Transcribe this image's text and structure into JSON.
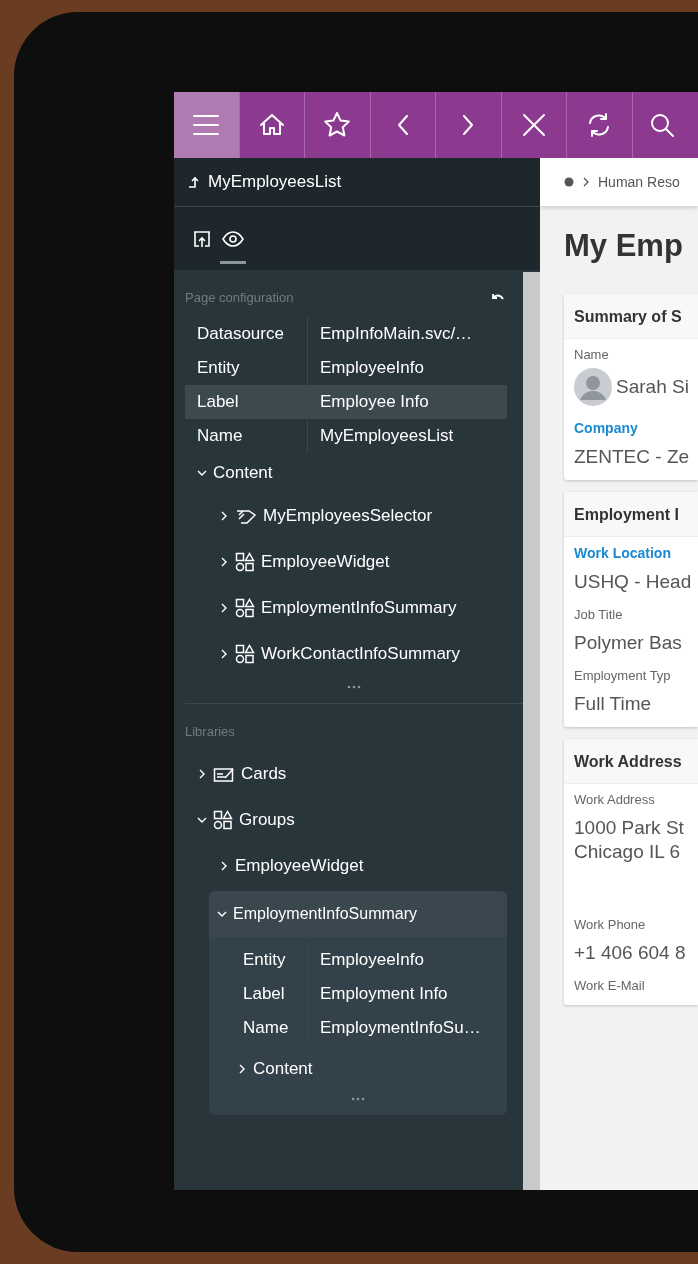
{
  "toolbar": {
    "buttons": [
      {
        "kind": "menu",
        "selected": true
      },
      {
        "kind": "home",
        "selected": false
      },
      {
        "kind": "star",
        "selected": false
      },
      {
        "kind": "back",
        "selected": false
      },
      {
        "kind": "forward",
        "selected": false
      },
      {
        "kind": "close",
        "selected": false
      },
      {
        "kind": "refresh",
        "selected": false
      },
      {
        "kind": "search",
        "selected": false
      }
    ]
  },
  "panel": {
    "title": "MyEmployeesList",
    "tabs": [
      {
        "kind": "publish",
        "selected": false
      },
      {
        "kind": "preview",
        "selected": true
      }
    ],
    "page_configuration": {
      "heading": "Page configuration",
      "properties": [
        {
          "name": "Datasource",
          "value": "EmpInfoMain.svc/…",
          "selected": false
        },
        {
          "name": "Entity",
          "value": "EmployeeInfo",
          "selected": false
        },
        {
          "name": "Label",
          "value": "Employee Info",
          "selected": true
        },
        {
          "name": "Name",
          "value": "MyEmployeesList",
          "selected": false
        }
      ],
      "content": {
        "label": "Content",
        "expanded": true,
        "children": [
          {
            "label": "MyEmployeesSelector",
            "kind": "selector",
            "expanded": false
          },
          {
            "label": "EmployeeWidget",
            "kind": "group",
            "expanded": false
          },
          {
            "label": "EmploymentInfoSummary",
            "kind": "group",
            "expanded": false
          },
          {
            "label": "WorkContactInfoSummary",
            "kind": "group",
            "expanded": false
          }
        ]
      }
    },
    "libraries": {
      "heading": "Libraries",
      "items": [
        {
          "label": "Cards",
          "kind": "cards",
          "expanded": false
        },
        {
          "label": "Groups",
          "kind": "group",
          "expanded": true,
          "children": [
            {
              "label": "EmployeeWidget",
              "expanded": false
            },
            {
              "label": "EmploymentInfoSummary",
              "expanded": true,
              "properties": [
                {
                  "name": "Entity",
                  "value": "EmployeeInfo"
                },
                {
                  "name": "Label",
                  "value": "Employment Info"
                },
                {
                  "name": "Name",
                  "value": "EmploymentInfoSu…"
                }
              ],
              "children": [
                {
                  "label": "Content",
                  "expanded": false
                }
              ]
            }
          ]
        }
      ]
    }
  },
  "main": {
    "breadcrumb": [
      "Human Reso"
    ],
    "title": "My Emp",
    "cards": [
      {
        "title": "Summary of S",
        "fields": [
          {
            "label": "Name",
            "emphasis": false,
            "kind": "person",
            "value": "Sarah Si"
          },
          {
            "label": "Company",
            "emphasis": true,
            "kind": "text",
            "value": "ZENTEC - Ze"
          }
        ]
      },
      {
        "title": "Employment I",
        "fields": [
          {
            "label": "Work Location",
            "emphasis": true,
            "kind": "text",
            "value": "USHQ - Head"
          },
          {
            "label": "Job Title",
            "emphasis": false,
            "kind": "text",
            "value": "Polymer Bas"
          },
          {
            "label": "Employment Typ",
            "emphasis": false,
            "kind": "text",
            "value": "Full Time"
          }
        ]
      },
      {
        "title": "Work Address",
        "fields": [
          {
            "label": "Work Address",
            "emphasis": false,
            "kind": "address",
            "lines": [
              "1000 Park St",
              "Chicago IL 6"
            ]
          },
          {
            "label": "Work Phone",
            "emphasis": false,
            "kind": "text",
            "value": "+1 406 604 8"
          },
          {
            "label": "Work E-Mail",
            "emphasis": false,
            "kind": "label"
          }
        ]
      }
    ]
  }
}
